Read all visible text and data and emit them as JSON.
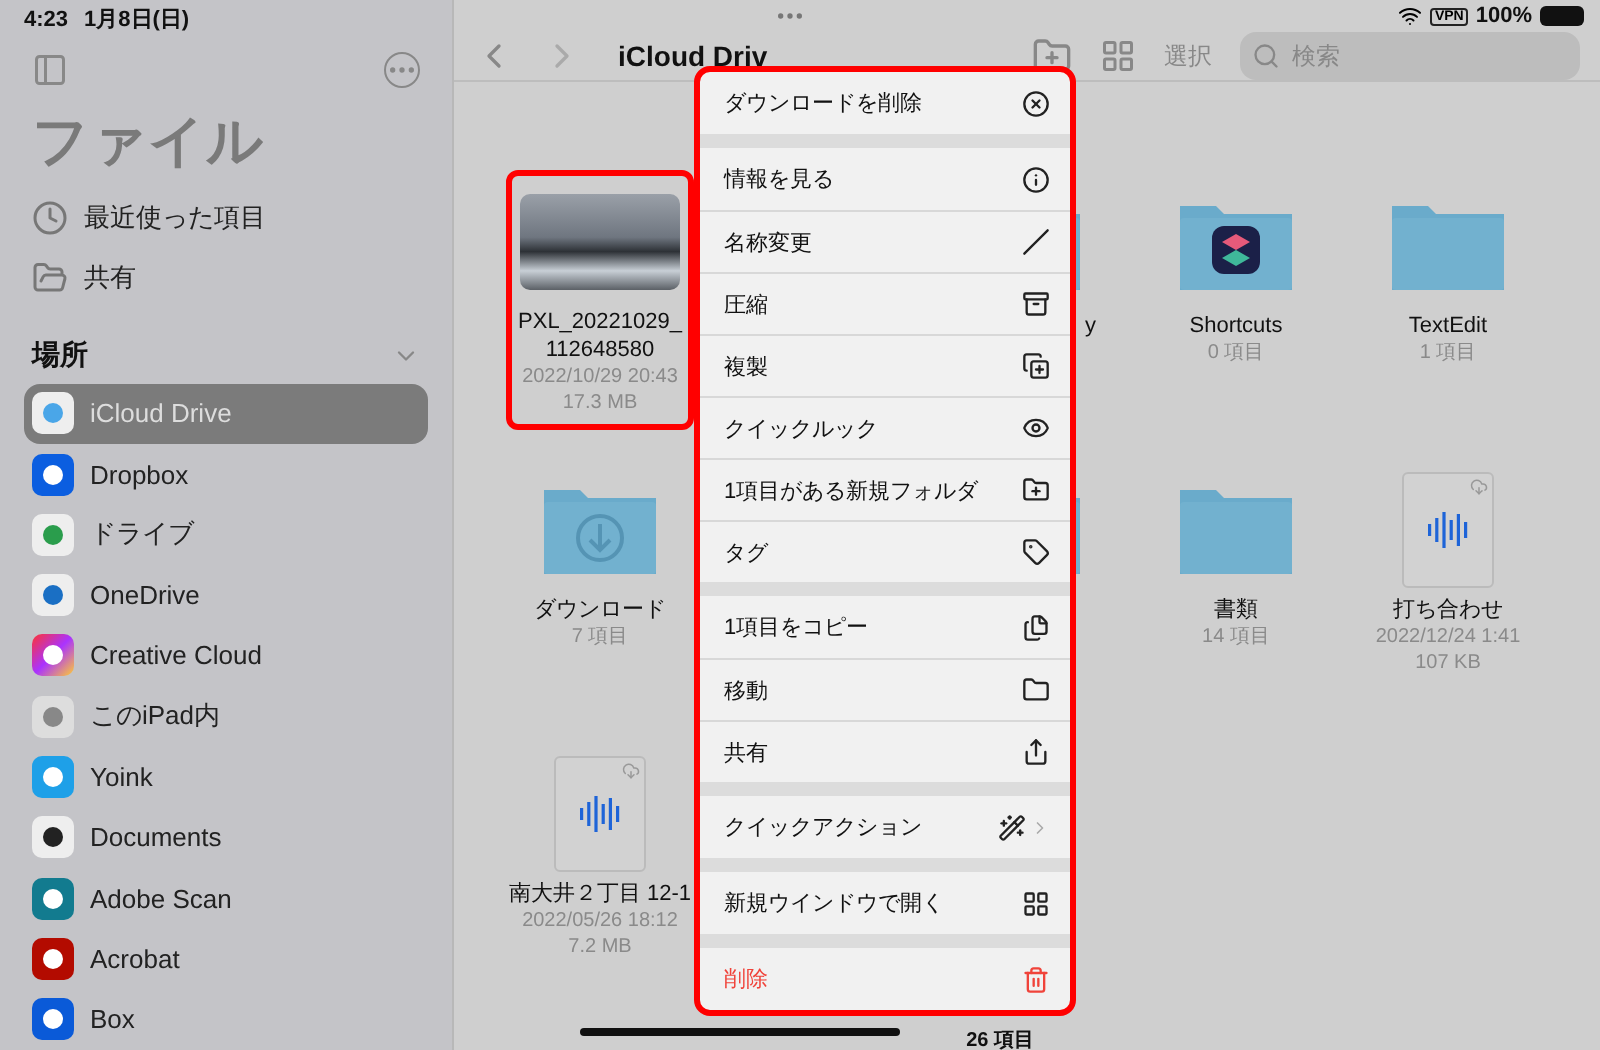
{
  "status_bar": {
    "time": "4:23",
    "date": "1月8日(日)",
    "vpn": "VPN",
    "battery": "100%"
  },
  "sidebar": {
    "title": "ファイル",
    "items": [
      {
        "label": "最近使った項目"
      },
      {
        "label": "共有"
      }
    ],
    "section": {
      "title": "場所",
      "expanded": true,
      "locations": [
        {
          "label": "iCloud Drive",
          "selected": true
        },
        {
          "label": "Dropbox",
          "selected": false
        },
        {
          "label": "ドライブ",
          "selected": false
        },
        {
          "label": "OneDrive",
          "selected": false
        },
        {
          "label": "Creative Cloud",
          "selected": false
        },
        {
          "label": "このiPad内",
          "selected": false
        },
        {
          "label": "Yoink",
          "selected": false
        },
        {
          "label": "Documents",
          "selected": false
        },
        {
          "label": "Adobe Scan",
          "selected": false
        },
        {
          "label": "Acrobat",
          "selected": false
        },
        {
          "label": "Box",
          "selected": false
        }
      ]
    }
  },
  "toolbar": {
    "title": "iCloud Driv",
    "select": "選択",
    "search": {
      "placeholder": "検索"
    }
  },
  "files": [
    {
      "kind": "image",
      "name": "PXL_20221029_112648580",
      "date": "2022/10/29 20:43",
      "size": "17.3 MB",
      "highlighted": true
    },
    {
      "kind": "covered"
    },
    {
      "kind": "folder",
      "name": "y",
      "cut_off": true
    },
    {
      "kind": "app-folder",
      "name": "Shortcuts",
      "count": "0 項目"
    },
    {
      "kind": "folder",
      "name": "TextEdit",
      "count": "1 項目"
    },
    {
      "kind": "download-folder",
      "name": "ダウンロード",
      "count": "7 項目"
    },
    {
      "kind": "covered"
    },
    {
      "kind": "folder"
    },
    {
      "kind": "folder",
      "name": "書類",
      "count": "14 項目"
    },
    {
      "kind": "audio",
      "name": "打ち合わせ",
      "date": "2022/12/24 1:41",
      "size": "107 KB"
    },
    {
      "kind": "audio",
      "name": "南大井２丁目 12-1",
      "date": "2022/05/26 18:12",
      "size": "7.2 MB"
    }
  ],
  "item_count": "26 項目",
  "context_menu": {
    "highlighted": true,
    "groups": [
      {
        "items": [
          {
            "label": "ダウンロードを削除"
          }
        ]
      },
      {
        "items": [
          {
            "label": "情報を見る"
          },
          {
            "label": "名称変更"
          },
          {
            "label": "圧縮"
          },
          {
            "label": "複製"
          },
          {
            "label": "クイックルック"
          },
          {
            "label": "1項目がある新規フォルダ"
          },
          {
            "label": "タグ"
          }
        ]
      },
      {
        "items": [
          {
            "label": "1項目をコピー"
          },
          {
            "label": "移動"
          },
          {
            "label": "共有"
          }
        ]
      },
      {
        "items": [
          {
            "label": "クイックアクション",
            "submenu": true
          }
        ]
      },
      {
        "items": [
          {
            "label": "新規ウインドウで開く"
          }
        ]
      },
      {
        "items": [
          {
            "label": "削除",
            "destructive": true
          }
        ]
      }
    ]
  }
}
